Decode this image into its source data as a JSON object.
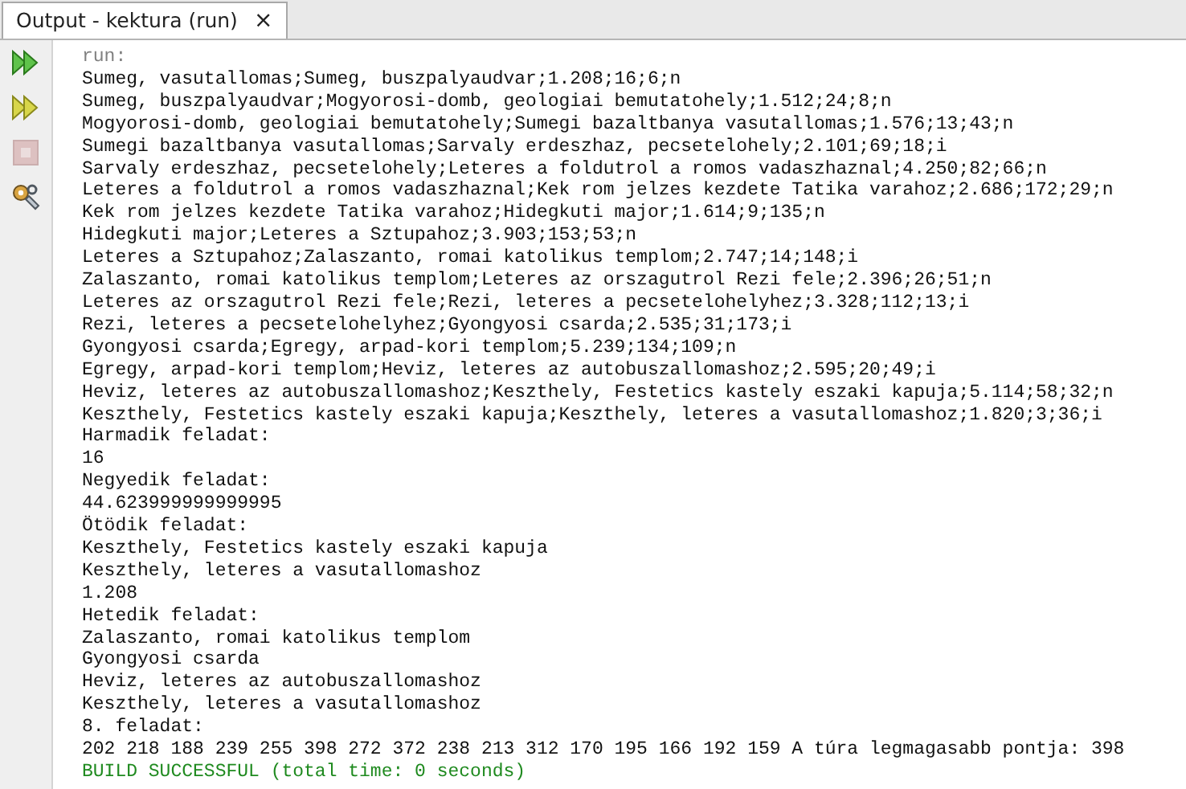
{
  "tab": {
    "title": "Output - kektura (run)",
    "close": "×",
    "selected": true
  },
  "toolbar": [
    {
      "kind": "rerun",
      "disabled": false
    },
    {
      "kind": "rerun-params",
      "disabled": false
    },
    {
      "kind": "stop",
      "disabled": true
    },
    {
      "kind": "settings",
      "disabled": false
    }
  ],
  "output": [
    {
      "kind": "info",
      "text": "run:"
    },
    {
      "kind": "out",
      "text": "Sumeg, vasutallomas;Sumeg, buszpalyaudvar;1.208;16;6;n"
    },
    {
      "kind": "out",
      "text": "Sumeg, buszpalyaudvar;Mogyorosi-domb, geologiai bemutatohely;1.512;24;8;n"
    },
    {
      "kind": "out",
      "text": "Mogyorosi-domb, geologiai bemutatohely;Sumegi bazaltbanya vasutallomas;1.576;13;43;n"
    },
    {
      "kind": "out",
      "text": "Sumegi bazaltbanya vasutallomas;Sarvaly erdeszhaz, pecsetelohely;2.101;69;18;i"
    },
    {
      "kind": "out",
      "text": "Sarvaly erdeszhaz, pecsetelohely;Leteres a foldutrol a romos vadaszhaznal;4.250;82;66;n"
    },
    {
      "kind": "out",
      "text": "Leteres a foldutrol a romos vadaszhaznal;Kek rom jelzes kezdete Tatika varahoz;2.686;172;29;n"
    },
    {
      "kind": "out",
      "text": "Kek rom jelzes kezdete Tatika varahoz;Hidegkuti major;1.614;9;135;n"
    },
    {
      "kind": "out",
      "text": "Hidegkuti major;Leteres a Sztupahoz;3.903;153;53;n"
    },
    {
      "kind": "out",
      "text": "Leteres a Sztupahoz;Zalaszanto, romai katolikus templom;2.747;14;148;i"
    },
    {
      "kind": "out",
      "text": "Zalaszanto, romai katolikus templom;Leteres az orszagutrol Rezi fele;2.396;26;51;n"
    },
    {
      "kind": "out",
      "text": "Leteres az orszagutrol Rezi fele;Rezi, leteres a pecsetelohelyhez;3.328;112;13;i"
    },
    {
      "kind": "out",
      "text": "Rezi, leteres a pecsetelohelyhez;Gyongyosi csarda;2.535;31;173;i"
    },
    {
      "kind": "out",
      "text": "Gyongyosi csarda;Egregy, arpad-kori templom;5.239;134;109;n"
    },
    {
      "kind": "out",
      "text": "Egregy, arpad-kori templom;Heviz, leteres az autobuszallomashoz;2.595;20;49;i"
    },
    {
      "kind": "out",
      "text": "Heviz, leteres az autobuszallomashoz;Keszthely, Festetics kastely eszaki kapuja;5.114;58;32;n"
    },
    {
      "kind": "out",
      "text": "Keszthely, Festetics kastely eszaki kapuja;Keszthely, leteres a vasutallomashoz;1.820;3;36;i"
    },
    {
      "kind": "out",
      "text": "Harmadik feladat:"
    },
    {
      "kind": "out",
      "text": "16"
    },
    {
      "kind": "out",
      "text": "Negyedik feladat:"
    },
    {
      "kind": "out",
      "text": "44.623999999999995"
    },
    {
      "kind": "out",
      "text": "Ötödik feladat:"
    },
    {
      "kind": "out",
      "text": "Keszthely, Festetics kastely eszaki kapuja"
    },
    {
      "kind": "out",
      "text": "Keszthely, leteres a vasutallomashoz"
    },
    {
      "kind": "out",
      "text": "1.208"
    },
    {
      "kind": "out",
      "text": "Hetedik feladat:"
    },
    {
      "kind": "out",
      "text": "Zalaszanto, romai katolikus templom"
    },
    {
      "kind": "out",
      "text": "Gyongyosi csarda"
    },
    {
      "kind": "out",
      "text": "Heviz, leteres az autobuszallomashoz"
    },
    {
      "kind": "out",
      "text": "Keszthely, leteres a vasutallomashoz"
    },
    {
      "kind": "out",
      "text": "8. feladat:"
    },
    {
      "kind": "out",
      "text": "202 218 188 239 255 398 272 372 238 213 312 170 195 166 192 159 A túra legmagasabb pontja: 398"
    },
    {
      "kind": "success",
      "text": "BUILD SUCCESSFUL (total time: 0 seconds)"
    }
  ]
}
